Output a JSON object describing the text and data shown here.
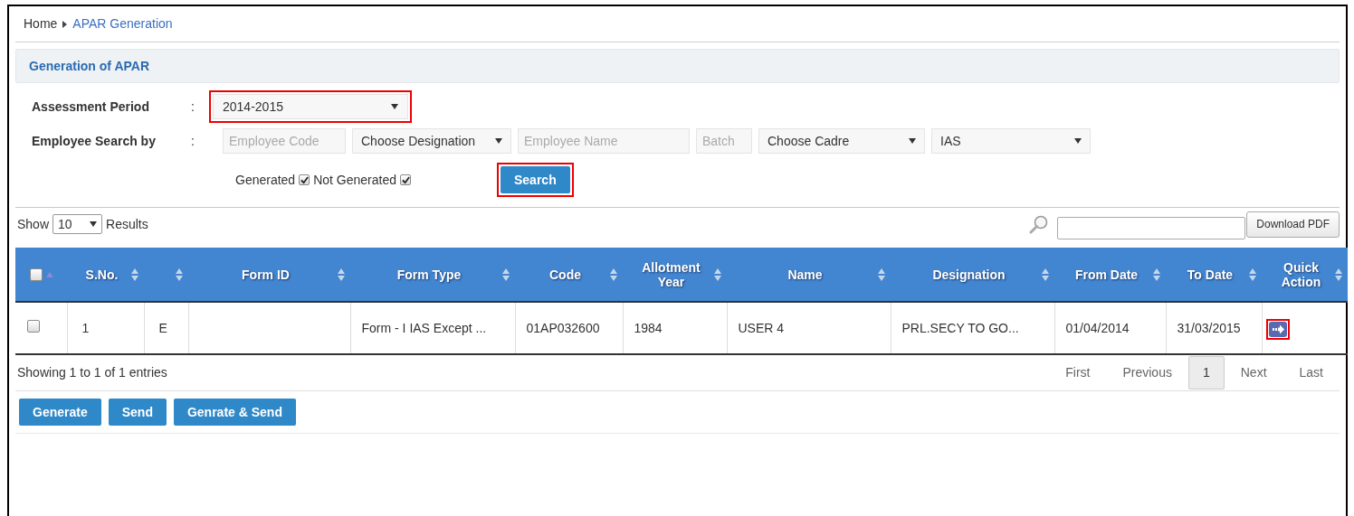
{
  "breadcrumb": [
    {
      "label": "Home",
      "current": false
    },
    {
      "label": "APAR Generation",
      "current": true
    }
  ],
  "panel": {
    "title": "Generation of APAR"
  },
  "form": {
    "assessment_period": {
      "label": "Assessment Period",
      "separator": ":",
      "value": "2014-2015"
    },
    "employee_search": {
      "label": "Employee Search by",
      "separator": ":",
      "fields": [
        {
          "kind": "input",
          "placeholder": "Employee Code"
        },
        {
          "kind": "select",
          "value": "Choose Designation"
        },
        {
          "kind": "input",
          "placeholder": "Employee Name"
        },
        {
          "kind": "input",
          "placeholder": "Batch"
        },
        {
          "kind": "select",
          "value": "Choose Cadre"
        },
        {
          "kind": "select",
          "value": "IAS"
        }
      ]
    },
    "filters": [
      {
        "label": "Generated",
        "checked": true
      },
      {
        "label": "Not Generated",
        "checked": true
      }
    ],
    "search_button": "Search"
  },
  "table_controls": {
    "show_label": "Show",
    "page_size": "10",
    "results_label": "Results",
    "download_button": "Download PDF"
  },
  "table": {
    "select_all": {
      "checked": false
    },
    "columns": [
      "S.No.",
      "",
      "Form ID",
      "Form Type",
      "Code",
      "Allotment Year",
      "Name",
      "Designation",
      "From Date",
      "To Date",
      "Quick Action"
    ],
    "rows": [
      {
        "checked": false,
        "cells": [
          "1",
          "E",
          "",
          "Form - I IAS Except ...",
          "01AP032600",
          "1984",
          "USER 4",
          "PRL.SECY TO GO...",
          "01/04/2014",
          "31/03/2015"
        ]
      }
    ]
  },
  "footer": {
    "info": "Showing 1 to 1 of 1 entries",
    "pagination": [
      {
        "label": "First",
        "selected": false
      },
      {
        "label": "Previous",
        "selected": false
      },
      {
        "label": "1",
        "selected": true
      },
      {
        "label": "Next",
        "selected": false
      },
      {
        "label": "Last",
        "selected": false
      }
    ]
  },
  "actions": [
    "Generate",
    "Send",
    "Genrate & Send"
  ]
}
